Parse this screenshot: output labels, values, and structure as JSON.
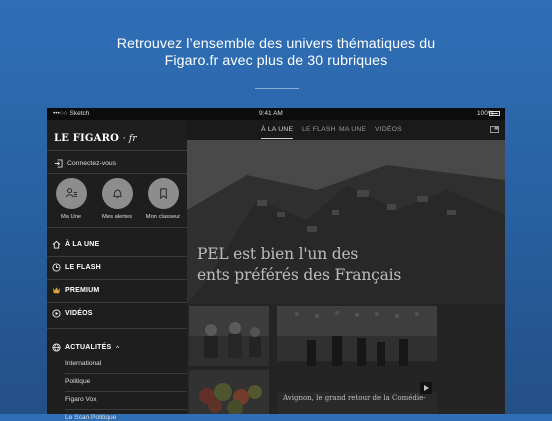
{
  "promo": {
    "line1": "Retrouvez l’ensemble des univers thématiques du",
    "line2": "Figaro.fr avec plus de 30 rubriques"
  },
  "statusbar": {
    "carrier": "•••○○ Sketch",
    "time": "9:41 AM",
    "battery": "100%"
  },
  "sidemenu": {
    "logo": "LE FIGARO",
    "logo_suffix": "· fr",
    "connect": "Connectez-vous",
    "shortcuts": [
      {
        "label": "Ma Une",
        "icon": "user-list-icon"
      },
      {
        "label": "Mes alertes",
        "icon": "bell-icon"
      },
      {
        "label": "Mon classeur",
        "icon": "bookmark-icon"
      }
    ],
    "nav": [
      {
        "label": "À LA UNE",
        "icon": "home-icon"
      },
      {
        "label": "LE FLASH",
        "icon": "clock-icon"
      },
      {
        "label": "PREMIUM",
        "icon": "premium-icon"
      },
      {
        "label": "VIDÉOS",
        "icon": "video-icon"
      },
      {
        "label": "ACTUALITÉS",
        "icon": "globe-icon"
      }
    ],
    "expand_glyph": "^",
    "subitems": [
      "International",
      "Politique",
      "Figaro Vox",
      "Le Scan Politique"
    ]
  },
  "tabs": [
    "À LA UNE",
    "LE FLASH",
    "MA UNE",
    "VIDÉOS"
  ],
  "hero": {
    "title_line1": "PEL est bien l'un des",
    "title_line2": "ents préférés des Français"
  },
  "card_right": {
    "caption": "Avignon, le grand retour de la Comédie-"
  },
  "colors": {
    "background": "#2f6fb8",
    "menu_bg": "#1e1e1e",
    "accent_premium": "#d9a640"
  }
}
